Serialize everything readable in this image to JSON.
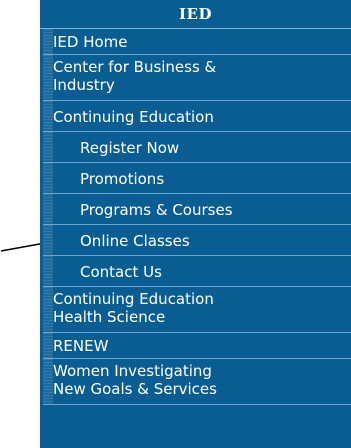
{
  "nav": {
    "title": "IED",
    "items": [
      {
        "label": "IED Home",
        "level": 0
      },
      {
        "label": "Center for Business &\nIndustry",
        "level": 0
      },
      {
        "label": "Continuing Education",
        "level": 0
      },
      {
        "label": "Register Now",
        "level": 1
      },
      {
        "label": "Promotions",
        "level": 1
      },
      {
        "label": "Programs & Courses",
        "level": 1
      },
      {
        "label": "Online Classes",
        "level": 1
      },
      {
        "label": "Contact Us",
        "level": 1
      },
      {
        "label": "Continuing Education\nHealth Science",
        "level": 0
      },
      {
        "label": "RENEW",
        "level": 0
      },
      {
        "label": "Women Investigating\nNew Goals & Services",
        "level": 0
      }
    ]
  },
  "icons": {
    "pointer_arrow": "arrow-right-icon"
  },
  "colors": {
    "nav_bg": "#0a5d93",
    "text": "#ffffff",
    "divider": "#6fa6cf"
  }
}
